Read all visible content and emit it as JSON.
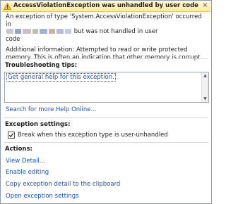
{
  "header": {
    "title": "AccessViolationException was unhandled by user code",
    "close_label": "×"
  },
  "message": {
    "line1_prefix": "An exception of type 'System.AccessViolationException' occurred in",
    "line2_suffix": "but was not handled in user",
    "line3": "code",
    "redacted_colors": [
      "#c7c7cc",
      "#8da6c4",
      "#d1bcc6",
      "#b4c4a8",
      "#9cb3d2",
      "#c9b39a",
      "#b8b8d8",
      "#c2cfe0"
    ],
    "additional_info": "Additional information: Attempted to read or write protected memory. This is often an indication that other memory is corrupt."
  },
  "troubleshooting": {
    "title": "Troubleshooting tips:",
    "tip_link": "Get general help for this exception.",
    "search_link": "Search for more Help Online..."
  },
  "exception_settings": {
    "title": "Exception settings:",
    "checkbox_label": "Break when this exception type is user-unhandled",
    "checked": true
  },
  "actions": {
    "title": "Actions:",
    "items": [
      "View Detail...",
      "Enable editing",
      "Copy exception detail to the clipboard",
      "Open exception settings"
    ]
  },
  "colors": {
    "header_bg": "#fde9a6",
    "link": "#1a52b8",
    "border": "#8e9aae"
  }
}
